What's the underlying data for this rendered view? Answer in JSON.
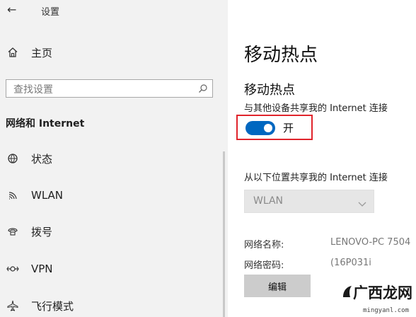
{
  "window": {
    "title": "设置",
    "back_icon": "back-arrow-icon"
  },
  "sidebar": {
    "home": {
      "label": "主页",
      "icon": "home-icon"
    },
    "search": {
      "placeholder": "查找设置",
      "icon": "search-icon"
    },
    "section_title": "网络和 Internet",
    "items": [
      {
        "label": "状态",
        "icon": "globe-icon"
      },
      {
        "label": "WLAN",
        "icon": "wifi-icon"
      },
      {
        "label": "拨号",
        "icon": "dialup-icon"
      },
      {
        "label": "VPN",
        "icon": "vpn-icon"
      },
      {
        "label": "飞行模式",
        "icon": "airplane-icon"
      }
    ]
  },
  "main": {
    "page_title": "移动热点",
    "section_title": "移动热点",
    "share_desc": "与其他设备共享我的 Internet 连接",
    "toggle": {
      "label": "开",
      "state": "on"
    },
    "share_from_label": "从以下位置共享我的 Internet 连接",
    "share_from_value": "WLAN",
    "network_name_label": "网络名称:",
    "network_name_value": "LENOVO-PC 7504",
    "network_password_label": "网络密码:",
    "network_password_value": "(16P031i",
    "edit_button": "编辑"
  },
  "watermark": {
    "text": "广西龙网",
    "url": "mingyanl.com"
  },
  "colors": {
    "accent": "#0067c0",
    "highlight_frame": "#e0242c",
    "sidebar_bg": "#f2f2f2"
  }
}
